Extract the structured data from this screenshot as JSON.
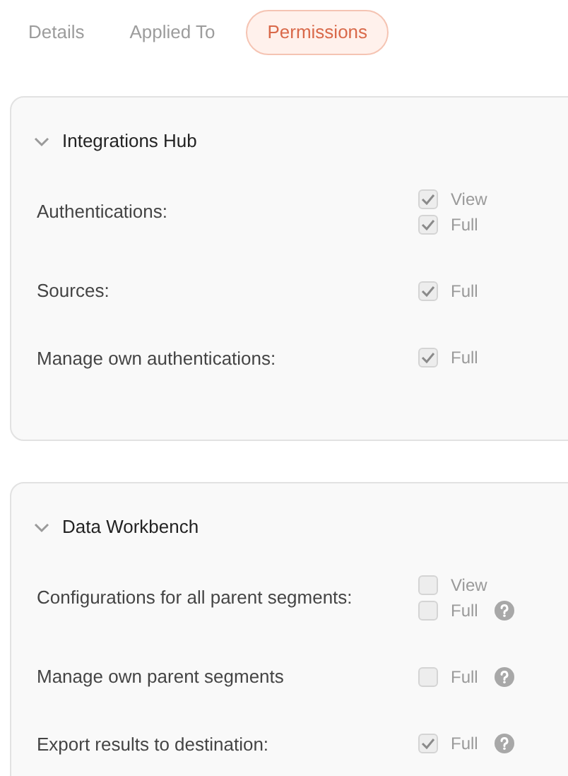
{
  "tabs": [
    {
      "label": "Details",
      "selected": false
    },
    {
      "label": "Applied To",
      "selected": false
    },
    {
      "label": "Permissions",
      "selected": true
    }
  ],
  "sections": [
    {
      "title": "Integrations Hub",
      "expanded": true,
      "rows": [
        {
          "label": "Authentications:",
          "options": [
            {
              "label": "View",
              "checked": true,
              "help": false
            },
            {
              "label": "Full",
              "checked": true,
              "help": false
            }
          ]
        },
        {
          "label": "Sources:",
          "options": [
            {
              "label": "Full",
              "checked": true,
              "help": false
            }
          ]
        },
        {
          "label": "Manage own authentications:",
          "options": [
            {
              "label": "Full",
              "checked": true,
              "help": false
            }
          ]
        }
      ]
    },
    {
      "title": "Data Workbench",
      "expanded": true,
      "rows": [
        {
          "label": "Configurations for all parent segments:",
          "options": [
            {
              "label": "View",
              "checked": false,
              "help": false
            },
            {
              "label": "Full",
              "checked": false,
              "help": true
            }
          ]
        },
        {
          "label": "Manage own parent segments",
          "options": [
            {
              "label": "Full",
              "checked": false,
              "help": true
            }
          ]
        },
        {
          "label": "Export results to destination:",
          "options": [
            {
              "label": "Full",
              "checked": true,
              "help": true
            }
          ]
        }
      ]
    }
  ]
}
